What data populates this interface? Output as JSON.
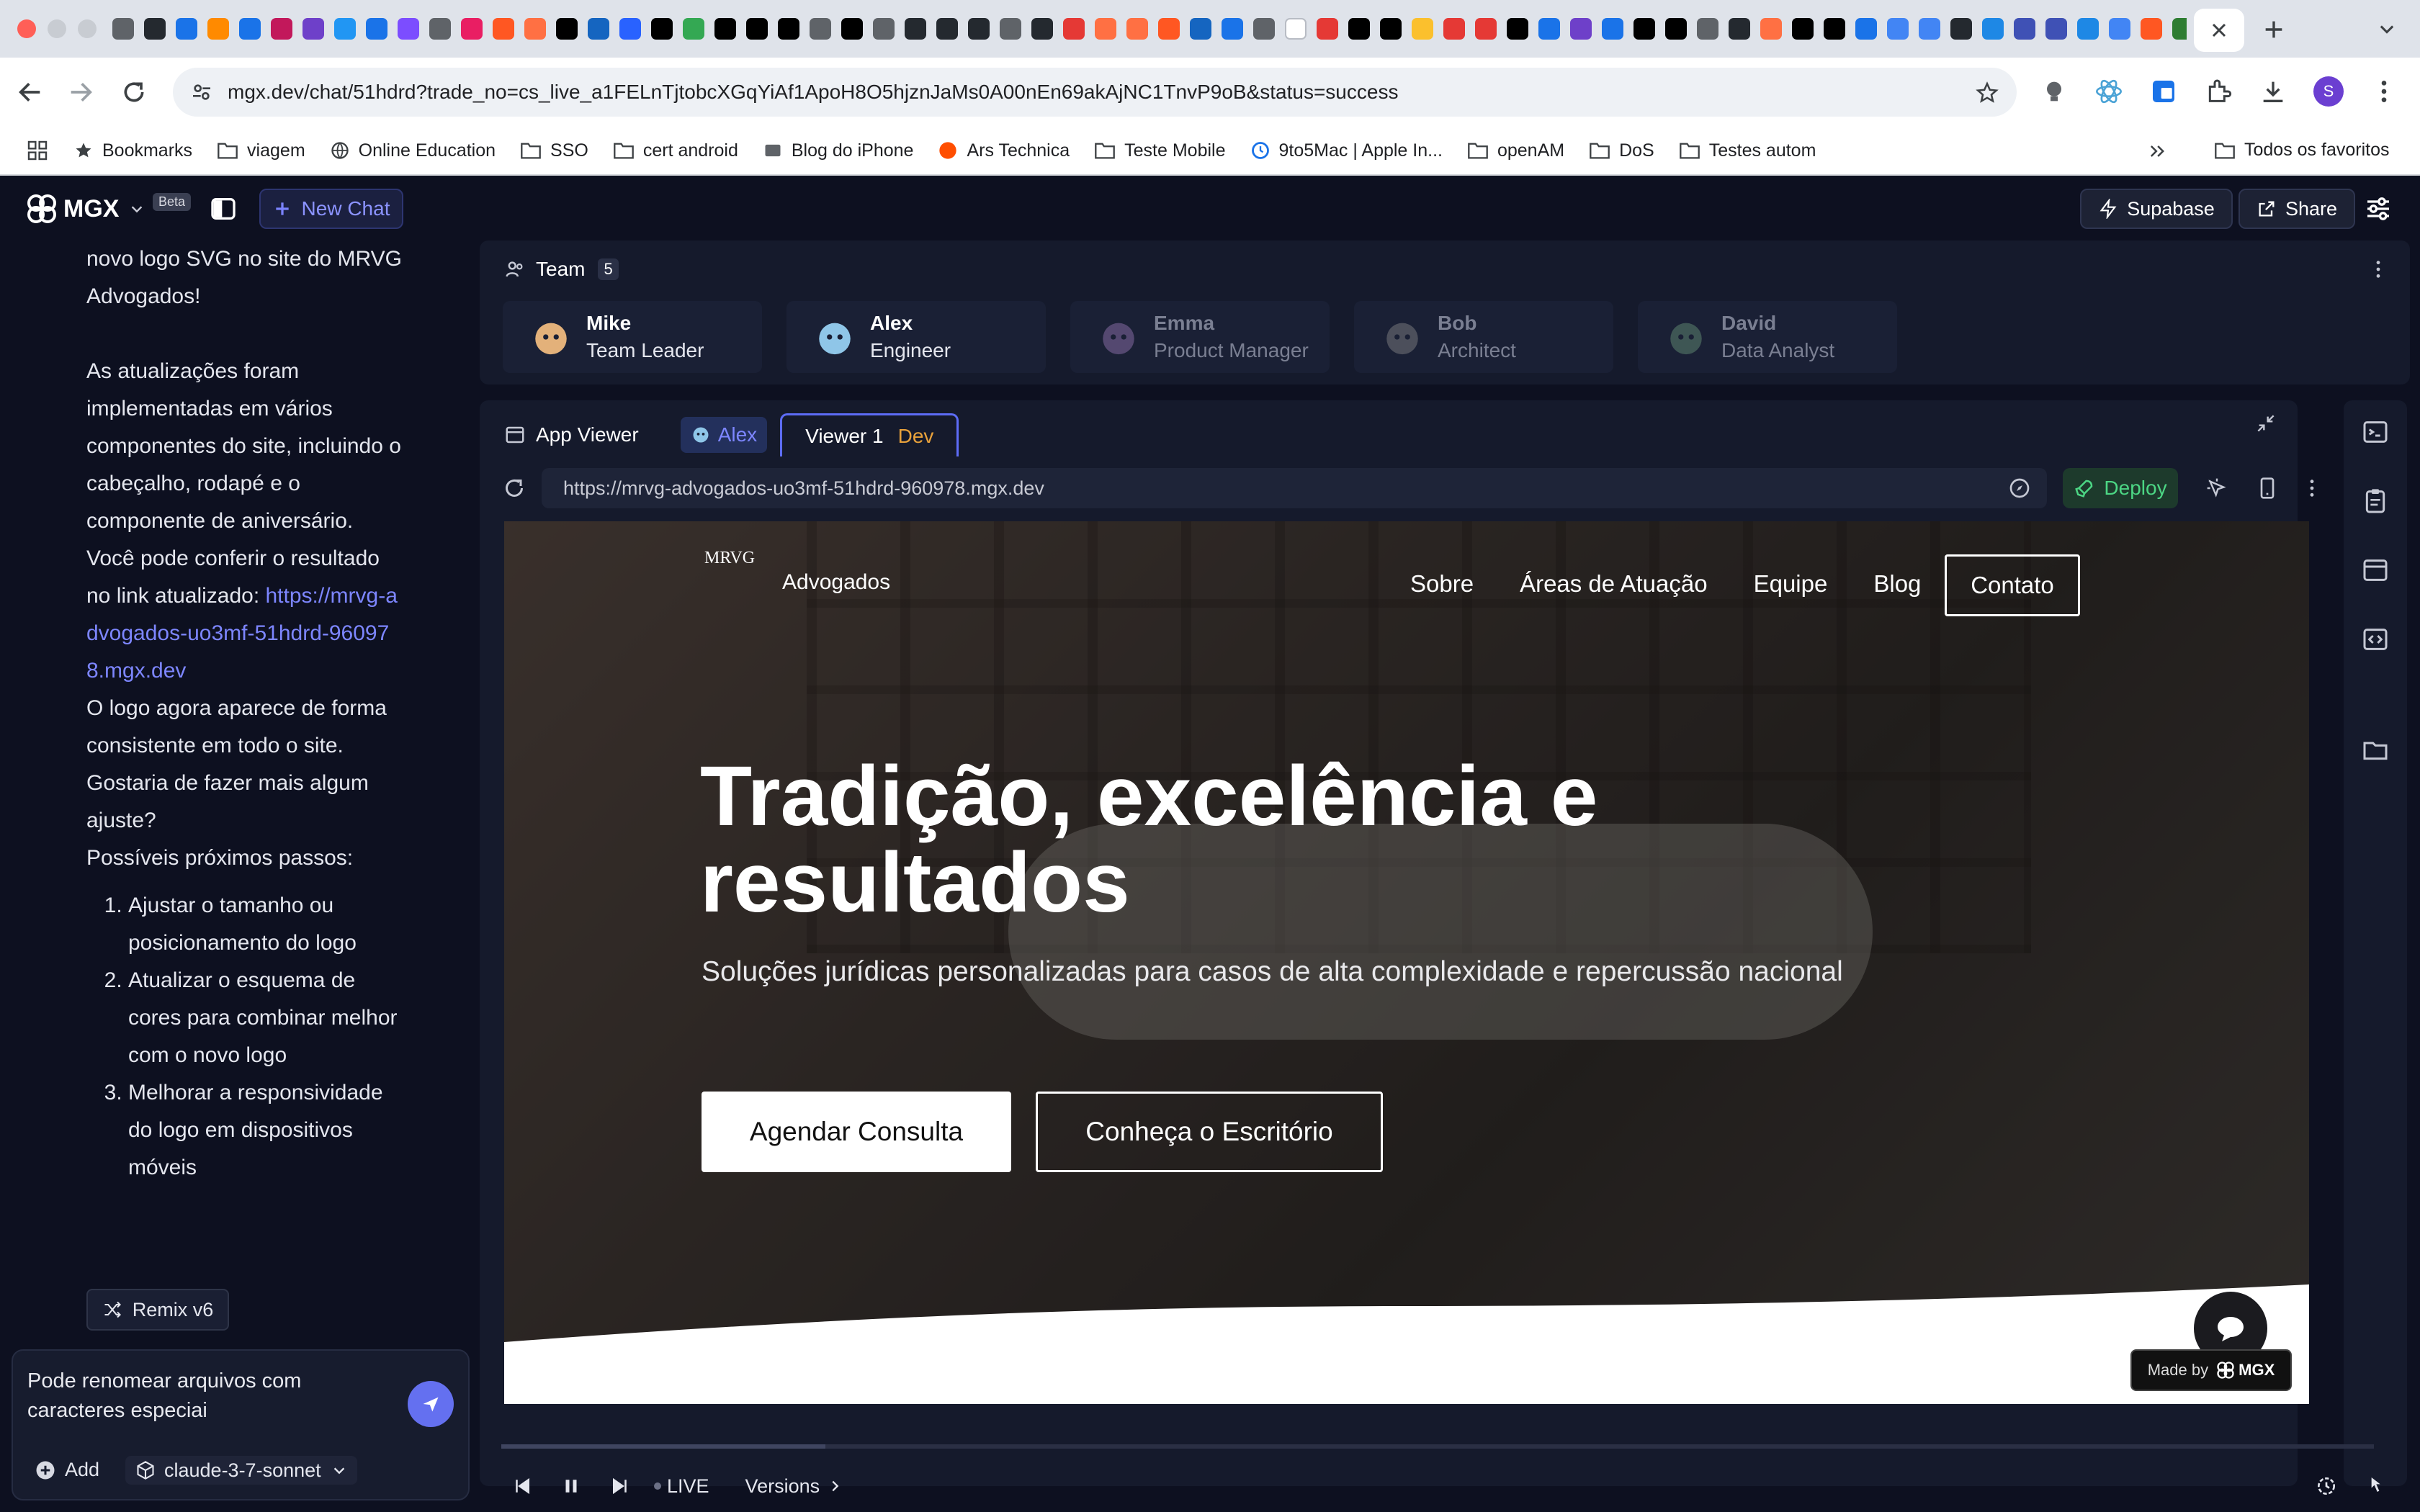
{
  "browser": {
    "url": "mgx.dev/chat/51hdrd?trade_no=cs_live_a1FELnTjtobcXGqYiAf1ApoH8O5hjznJaMs0A00nEn69akAjNC1TnvP9oB&status=success",
    "profile_initial": "S",
    "bookmarks": [
      "Bookmarks",
      "viagem",
      "Online Education",
      "SSO",
      "cert android",
      "Blog do iPhone",
      "Ars Technica",
      "Teste Mobile",
      "9to5Mac | Apple In...",
      "openAM",
      "DoS",
      "Testes autom"
    ],
    "all_bookmarks": "Todos os favoritos",
    "tab_colors": [
      "#5f6368",
      "#24292f",
      "#1a73e8",
      "#ff8a00",
      "#1a73e8",
      "#c2185b",
      "#6e40c9",
      "#2196f3",
      "#1a73e8",
      "#7c4dff",
      "#5f6368",
      "#e91e63",
      "#ff5722",
      "#ff7043",
      "#000000",
      "#1565c0",
      "#2962ff",
      "#000000",
      "#34a853",
      "#000000",
      "#000000",
      "#000000",
      "#5f6368",
      "#000000",
      "#5f6368",
      "#24292f",
      "#24292f",
      "#24292f",
      "#5f6368",
      "#24292f",
      "#e53935",
      "#ff7043",
      "#ff7043",
      "#ff5722",
      "#1565c0",
      "#1a73e8",
      "#5f6368",
      "#ffffff",
      "#e53935",
      "#000000",
      "#000000",
      "#fbc02d",
      "#e53935",
      "#e53935",
      "#000000",
      "#1a73e8",
      "#6e40c9",
      "#1a73e8",
      "#000000",
      "#000000",
      "#5f6368",
      "#24292f",
      "#ff7043",
      "#000000",
      "#000000",
      "#1a73e8",
      "#4285f4",
      "#4285f4",
      "#24292f",
      "#1e88e5",
      "#3f51b5",
      "#3f51b5",
      "#1e88e5",
      "#4285f4",
      "#ff5722",
      "#2e7d32",
      "#24292f",
      "#24292f",
      "#ffffff",
      "#ffffff",
      "#000000",
      "#000000",
      "#5f6368"
    ]
  },
  "app": {
    "brand": "MGX",
    "beta": "Beta",
    "new_chat": "New Chat",
    "supabase": "Supabase",
    "share": "Share"
  },
  "chat": {
    "p1": "novo logo SVG no site do MRVG Advogados!",
    "p2_before": "As atualizações foram implementadas em vários componentes do site, incluindo o cabeçalho, rodapé e o componente de aniversário. Você pode conferir o resultado no link atualizado: ",
    "p2_link": "https://mrvg-advogados-uo3mf-51hdrd-960978.mgx.dev",
    "p3": "O logo agora aparece de forma consistente em todo o site. Gostaria de fazer mais algum ajuste?",
    "p4": "Possíveis próximos passos:",
    "steps": [
      "Ajustar o tamanho ou posicionamento do logo",
      "Atualizar o esquema de cores para combinar melhor com o novo logo",
      "Melhorar a responsividade do logo em dispositivos móveis"
    ],
    "remix": "Remix v6",
    "input_value": "Pode renomear arquivos com caracteres especiai",
    "add": "Add",
    "model": "claude-3-7-sonnet"
  },
  "team": {
    "label": "Team",
    "count": "5",
    "members": [
      {
        "name": "Mike",
        "role": "Team Leader",
        "active": true,
        "color": "#e3b17a"
      },
      {
        "name": "Alex",
        "role": "Engineer",
        "active": true,
        "color": "#8fc6e8"
      },
      {
        "name": "Emma",
        "role": "Product Manager",
        "active": false,
        "color": "#9b7ab8"
      },
      {
        "name": "Bob",
        "role": "Architect",
        "active": false,
        "color": "#8a8a8a"
      },
      {
        "name": "David",
        "role": "Data Analyst",
        "active": false,
        "color": "#6a9a7a"
      }
    ]
  },
  "viewer": {
    "app_viewer": "App Viewer",
    "alex_tab": "Alex",
    "viewer_tab": "Viewer 1",
    "dev_badge": "Dev",
    "url": "https://mrvg-advogados-uo3mf-51hdrd-960978.mgx.dev",
    "deploy": "Deploy",
    "live": "LIVE",
    "versions": "Versions"
  },
  "site": {
    "logo": "MRVG",
    "brand": "Advogados",
    "nav": [
      "Sobre",
      "Áreas de Atuação",
      "Equipe",
      "Blog"
    ],
    "contact": "Contato",
    "headline": "Tradição, excelência e resultados",
    "subtitle": "Soluções jurídicas personalizadas para casos de alta complexidade e repercussão nacional",
    "cta_primary": "Agendar Consulta",
    "cta_secondary": "Conheça o Escritório",
    "made_by": "Made by",
    "made_by_brand": "MGX"
  }
}
